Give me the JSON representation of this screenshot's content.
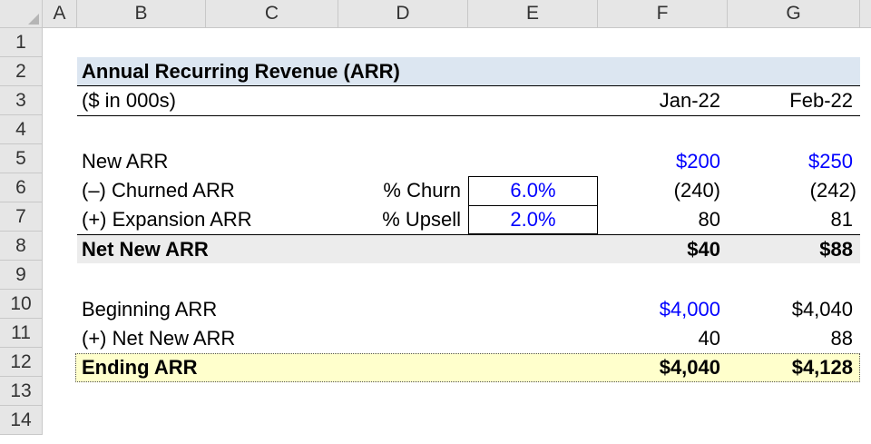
{
  "columns": [
    "A",
    "B",
    "C",
    "D",
    "E",
    "F",
    "G"
  ],
  "rows": [
    "1",
    "2",
    "3",
    "4",
    "5",
    "6",
    "7",
    "8",
    "9",
    "10",
    "11",
    "12",
    "13",
    "14"
  ],
  "sheet": {
    "title": "Annual Recurring Revenue (ARR)",
    "units": "($ in 000s)",
    "periods": [
      "Jan-22",
      "Feb-22"
    ],
    "new_arr": {
      "label": "New ARR",
      "values": [
        "$200",
        "$250"
      ]
    },
    "churned_arr": {
      "label": "(–) Churned ARR",
      "assumption_label": "% Churn",
      "assumption_value": "6.0%",
      "values": [
        "(240)",
        "(242)"
      ]
    },
    "expansion_arr": {
      "label": "(+) Expansion ARR",
      "assumption_label": "% Upsell",
      "assumption_value": "2.0%",
      "values": [
        "80",
        "81"
      ]
    },
    "net_new_arr": {
      "label": "Net New ARR",
      "values": [
        "$40",
        "$88"
      ]
    },
    "beginning_arr": {
      "label": "Beginning ARR",
      "values": [
        "$4,000",
        "$4,040"
      ]
    },
    "net_new_arr_link": {
      "label": "(+) Net New ARR",
      "values": [
        "40",
        "88"
      ]
    },
    "ending_arr": {
      "label": "Ending ARR",
      "values": [
        "$4,040",
        "$4,128"
      ]
    }
  },
  "colors": {
    "title_band": "#dce6f1",
    "subtotal_band": "#ececec",
    "total_band": "#ffffcc",
    "input_blue": "#0000ff",
    "header_gray": "#e6e6e6"
  }
}
